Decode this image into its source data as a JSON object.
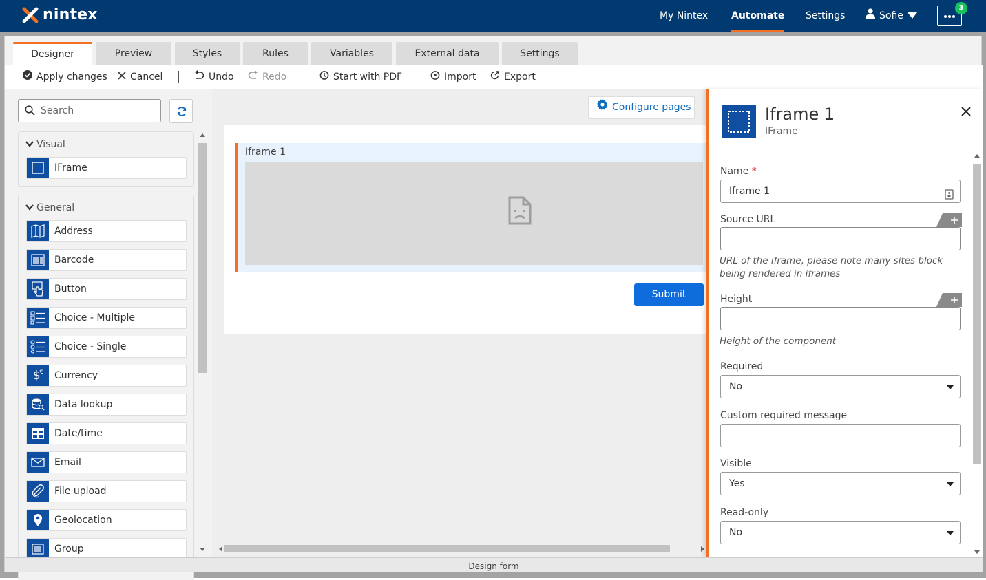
{
  "brand": {
    "logo_text": "nintex",
    "accent": "#f36f21",
    "primary": "#003a70",
    "button_blue": "#0f6cdc"
  },
  "topnav": {
    "my_nintex": "My Nintex",
    "automate": "Automate",
    "settings": "Settings",
    "user": "Sofie",
    "notifications": "3"
  },
  "tabs": [
    {
      "label": "Designer",
      "active": true
    },
    {
      "label": "Preview"
    },
    {
      "label": "Styles"
    },
    {
      "label": "Rules"
    },
    {
      "label": "Variables"
    },
    {
      "label": "External data"
    },
    {
      "label": "Settings"
    }
  ],
  "toolbar": {
    "apply": "Apply changes",
    "cancel": "Cancel",
    "undo": "Undo",
    "redo": "Redo",
    "start_pdf": "Start with PDF",
    "import": "Import",
    "export": "Export"
  },
  "palette": {
    "search_placeholder": "Search",
    "groups": [
      {
        "title": "Visual",
        "items": [
          {
            "label": "IFrame",
            "icon": "iframe-icon"
          }
        ]
      },
      {
        "title": "General",
        "items": [
          {
            "label": "Address",
            "icon": "map-icon"
          },
          {
            "label": "Barcode",
            "icon": "barcode-icon"
          },
          {
            "label": "Button",
            "icon": "pointer-hand-icon"
          },
          {
            "label": "Choice - Multiple",
            "icon": "checklist-icon"
          },
          {
            "label": "Choice - Single",
            "icon": "radio-list-icon"
          },
          {
            "label": "Currency",
            "icon": "currency-icon"
          },
          {
            "label": "Data lookup",
            "icon": "database-search-icon"
          },
          {
            "label": "Date/time",
            "icon": "calendar-icon"
          },
          {
            "label": "Email",
            "icon": "envelope-icon"
          },
          {
            "label": "File upload",
            "icon": "paperclip-icon"
          },
          {
            "label": "Geolocation",
            "icon": "map-pin-icon"
          },
          {
            "label": "Group",
            "icon": "group-icon"
          }
        ]
      }
    ]
  },
  "canvas": {
    "configure_pages": "Configure pages",
    "iframe_label": "Iframe 1",
    "submit": "Submit"
  },
  "panel": {
    "title": "Iframe 1",
    "subtitle": "IFrame",
    "name_label": "Name",
    "name_required_marker": "*",
    "name_value": "Iframe 1",
    "source_url_label": "Source URL",
    "source_url_value": "",
    "source_url_hint": "URL of the iframe, please note many sites block being rendered in iframes",
    "height_label": "Height",
    "height_value": "",
    "height_hint": "Height of the component",
    "required_label": "Required",
    "required_value": "No",
    "custom_required_label": "Custom required message",
    "custom_required_value": "",
    "visible_label": "Visible",
    "visible_value": "Yes",
    "readonly_label": "Read-only",
    "readonly_value": "No"
  },
  "footer": {
    "label": "Design form"
  }
}
